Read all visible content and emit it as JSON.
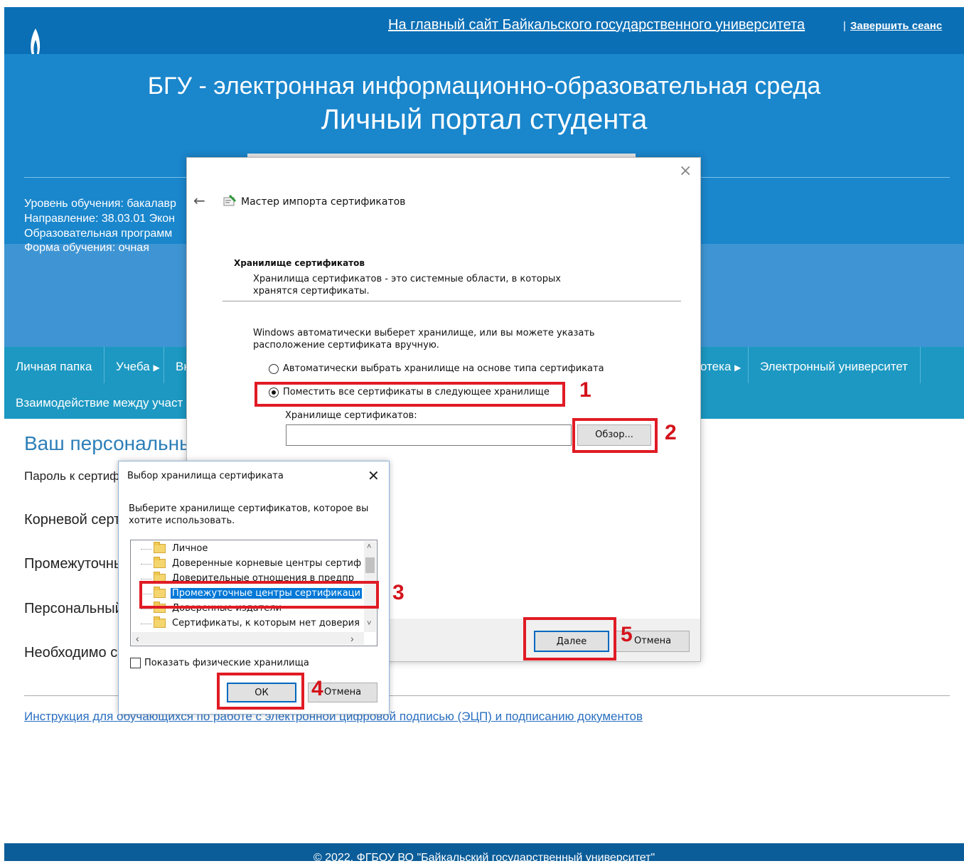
{
  "topbar": {
    "main_link": "На главный сайт Байкальского государственного университета",
    "separator": "|",
    "end_session": "Завершить сеанс"
  },
  "header": {
    "title_line1": "БГУ - электронная информационно-образовательная среда",
    "title_line2": "Личный портал студента",
    "info": [
      "Уровень обучения: бакалавр",
      "Направление: 38.03.01 Экон",
      "Образовательная программ",
      "Форма обучения: очная"
    ]
  },
  "nav": {
    "items": [
      {
        "label": "Личная папка",
        "arrow": ""
      },
      {
        "label": "Учеба",
        "arrow": "▶"
      },
      {
        "label": "Вн",
        "arrow": ""
      },
      {
        "label": "отека",
        "arrow": "▶"
      },
      {
        "label": "Электронный университет",
        "arrow": ""
      },
      {
        "label": "Взаимодействие между участ",
        "arrow": ""
      }
    ]
  },
  "content": {
    "title": "Ваш персональны",
    "lines": [
      "Пароль к сертиф",
      "Корневой серт",
      "Промежуточны",
      "Персональный",
      "Необходимо с"
    ],
    "instruction_link": "Инструкция для обучающихся по работе с электронной цифровой подписью (ЭЦП) и подписанию документов"
  },
  "footer": {
    "text": "© 2022, ФГБОУ ВО \"Байкальский государственный университет\""
  },
  "wizard": {
    "close": "×",
    "back": "←",
    "title": "Мастер импорта сертификатов",
    "section_title": "Хранилище сертификатов",
    "section_desc": "Хранилища сертификатов - это системные области, в которых хранятся сертификаты.",
    "note": "Windows автоматически выберет хранилище, или вы можете указать расположение сертификата вручную.",
    "radio_auto": "Автоматически выбрать хранилище на основе типа сертификата",
    "radio_manual": "Поместить все сертификаты в следующее хранилище",
    "store_label": "Хранилище сертификатов:",
    "store_value": "",
    "browse": "Обзор...",
    "next": "Далее",
    "cancel": "Отмена"
  },
  "select_dialog": {
    "title": "Выбор хранилища сертификата",
    "close": "✕",
    "desc": "Выберите хранилище сертификатов, которое вы хотите использовать.",
    "items": [
      "Личное",
      "Доверенные корневые центры сертиф",
      "Доверительные отношения в предпр",
      "Промежуточные центры сертификаци",
      "Доверенные издатели",
      "Сертификаты, к которым нет доверия"
    ],
    "selected_index": 3,
    "show_physical": "Показать физические хранилища",
    "ok": "ОК",
    "cancel": "Отмена"
  },
  "annotations": [
    "1",
    "2",
    "3",
    "4",
    "5"
  ],
  "colors": {
    "accent": "#1a86cc",
    "annotation": "#e01b24",
    "selection": "#0078d7"
  }
}
